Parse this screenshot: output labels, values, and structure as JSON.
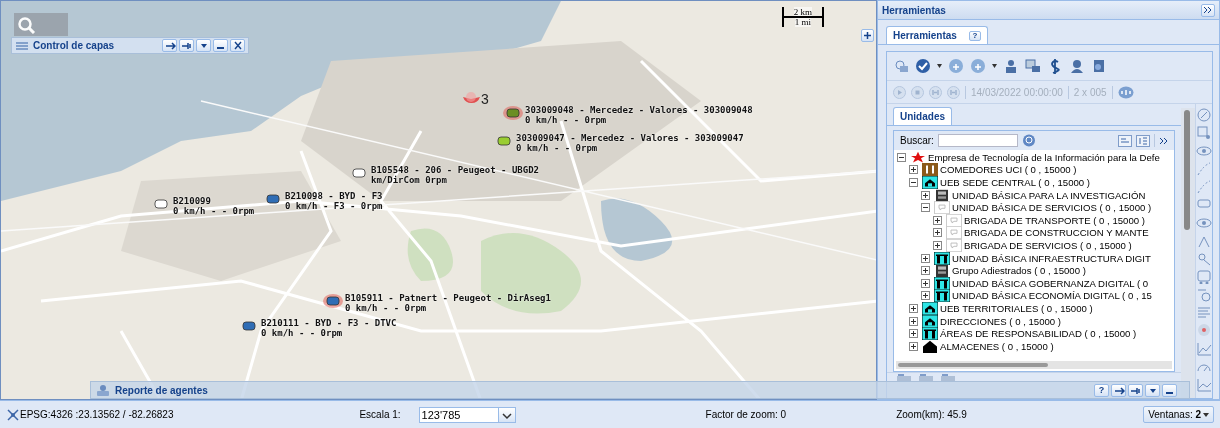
{
  "layer_panel": {
    "title": "Control de capas"
  },
  "map": {
    "scale": [
      "2 km",
      "1 mi"
    ],
    "cluster": {
      "count": "3"
    },
    "vehicles": [
      {
        "label": "303009048 - Mercedez - Valores - 303009048",
        "status": "0 km/h - - 0rpm",
        "color": "#6b8e23",
        "highlighted": true
      },
      {
        "label": "303009047 - Mercedez - Valores - 303009047",
        "status": "0 km/h - - 0rpm",
        "color": "#9acd32",
        "highlighted": false
      },
      {
        "label": "B105548 - 206 - Peugeot - UBGD2",
        "status": "km/DirCom 0rpm",
        "color": "#ffffff",
        "highlighted": false
      },
      {
        "label": "B210099",
        "status": "0 km/h - - 0rpm",
        "color": "#ffffff",
        "highlighted": false
      },
      {
        "label": "B210098 - BYD - F3",
        "status": "0 km/h - F3 - 0rpm",
        "color": "#2f6db5",
        "highlighted": false
      },
      {
        "label": "B105911 - Patnert - Peugeot - DirAseg1",
        "status": "0 km/h - - 0rpm",
        "color": "#2f6db5",
        "highlighted": true
      },
      {
        "label": "B210111 - BYD - F3 - DTVC",
        "status": "0 km/h - - 0rpm",
        "color": "#2f6db5",
        "highlighted": false
      }
    ]
  },
  "report_panel": {
    "title": "Reporte de agentes",
    "help": "?"
  },
  "tools_panel": {
    "title": "Herramientas",
    "tab": {
      "label": "Herramientas",
      "selected": true,
      "help": "?"
    },
    "playback": {
      "date": "14/03/2022 00:00:00",
      "speed": "2 x 005"
    },
    "units_tab": {
      "label": "Unidades",
      "selected": true
    },
    "search": {
      "label": "Buscar:"
    },
    "tree": [
      {
        "label": "Empresa de Tecnología de la Información para la Defe",
        "kind": "star",
        "expanded": true,
        "children": [
          {
            "label": "COMEDORES UCI ( 0 , 15000 )",
            "kind": "cutlery",
            "expanded": false
          },
          {
            "label": "UEB SEDE CENTRAL ( 0 , 15000 )",
            "kind": "house",
            "expanded": true,
            "children": [
              {
                "label": "UNIDAD BÁSICA PARA LA INVESTIGACIÓN",
                "kind": "building",
                "expanded": false
              },
              {
                "label": "UNIDAD BÁSICA DE SERVICIOS ( 0 , 15000 )",
                "kind": "blank",
                "expanded": true,
                "children": [
                  {
                    "label": "BRIGADA DE TRANSPORTE ( 0 , 15000 )",
                    "kind": "blank",
                    "expanded": false
                  },
                  {
                    "label": "BRIGADA DE CONSTRUCCION Y MANTE",
                    "kind": "blank",
                    "expanded": false
                  },
                  {
                    "label": "BRIGADA DE SERVICIOS ( 0 , 15000 )",
                    "kind": "blank",
                    "expanded": false
                  }
                ]
              },
              {
                "label": "UNIDAD BÁSICA INFRAESTRUCTURA DIGIT",
                "kind": "arch",
                "expanded": false
              },
              {
                "label": "Grupo Adiestrados ( 0 , 15000 )",
                "kind": "building",
                "expanded": false
              },
              {
                "label": "UNIDAD BÁSICA GOBERNANZA DIGITAL ( 0",
                "kind": "arch",
                "expanded": false
              },
              {
                "label": "UNIDAD BÁSICA ECONOMÍA DIGITAL ( 0 , 15",
                "kind": "arch",
                "expanded": false
              }
            ]
          },
          {
            "label": "UEB TERRITORIALES ( 0 , 15000 )",
            "kind": "house",
            "expanded": false
          },
          {
            "label": "DIRECCIONES ( 0 , 15000 )",
            "kind": "house",
            "expanded": false
          },
          {
            "label": "ÁREAS DE RESPONSABILIDAD ( 0 , 15000 )",
            "kind": "arch",
            "expanded": false
          },
          {
            "label": "ALMACENES ( 0 , 15000 )",
            "kind": "dark-house",
            "expanded": false
          }
        ]
      }
    ]
  },
  "status_bar": {
    "coords": "EPSG:4326 :23.13562 / -82.26823",
    "scale_label": "Escala 1:",
    "scale_value": "123'785",
    "zoom_factor": "Factor de zoom: 0",
    "zoom_km": "Zoom(km): 45.9",
    "windows": "Ventanas: **2**"
  }
}
